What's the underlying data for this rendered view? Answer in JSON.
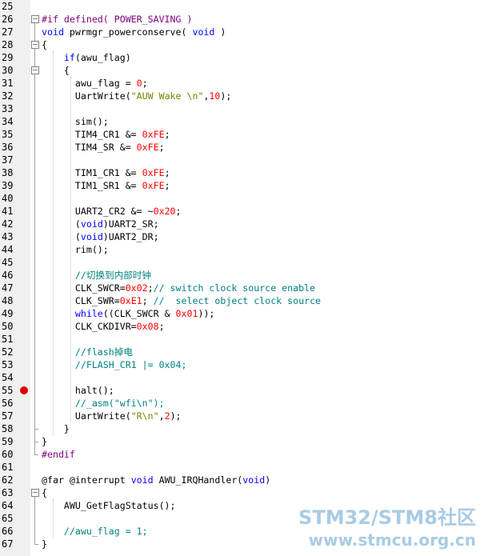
{
  "lines": [
    {
      "n": "25",
      "segs": []
    },
    {
      "n": "26",
      "segs": [
        {
          "t": "#if defined( POWER_SAVING )",
          "c": "pp"
        }
      ]
    },
    {
      "n": "27",
      "segs": [
        {
          "t": "void",
          "c": "kw"
        },
        {
          "t": " pwrmgr_powerconserve( "
        },
        {
          "t": "void",
          "c": "kw"
        },
        {
          "t": " )"
        }
      ]
    },
    {
      "n": "28",
      "segs": [
        {
          "t": "{"
        }
      ]
    },
    {
      "n": "29",
      "segs": [
        {
          "t": "    "
        },
        {
          "t": "if",
          "c": "kw"
        },
        {
          "t": "(awu_flag)"
        }
      ]
    },
    {
      "n": "30",
      "segs": [
        {
          "t": "    {"
        }
      ]
    },
    {
      "n": "31",
      "segs": [
        {
          "t": "      awu_flag = "
        },
        {
          "t": "0",
          "c": "num"
        },
        {
          "t": ";"
        }
      ]
    },
    {
      "n": "32",
      "segs": [
        {
          "t": "      UartWrite("
        },
        {
          "t": "\"AUW Wake \\n\"",
          "c": "str"
        },
        {
          "t": ","
        },
        {
          "t": "10",
          "c": "num"
        },
        {
          "t": ");"
        }
      ]
    },
    {
      "n": "33",
      "segs": []
    },
    {
      "n": "34",
      "segs": [
        {
          "t": "      sim();"
        }
      ]
    },
    {
      "n": "35",
      "segs": [
        {
          "t": "      TIM4_CR1 &= "
        },
        {
          "t": "0xFE",
          "c": "num"
        },
        {
          "t": ";"
        }
      ]
    },
    {
      "n": "36",
      "segs": [
        {
          "t": "      TIM4_SR &= "
        },
        {
          "t": "0xFE",
          "c": "num"
        },
        {
          "t": ";"
        }
      ]
    },
    {
      "n": "37",
      "segs": []
    },
    {
      "n": "38",
      "segs": [
        {
          "t": "      TIM1_CR1 &= "
        },
        {
          "t": "0xFE",
          "c": "num"
        },
        {
          "t": ";"
        }
      ]
    },
    {
      "n": "39",
      "segs": [
        {
          "t": "      TIM1_SR1 &= "
        },
        {
          "t": "0xFE",
          "c": "num"
        },
        {
          "t": ";"
        }
      ]
    },
    {
      "n": "40",
      "segs": []
    },
    {
      "n": "41",
      "segs": [
        {
          "t": "      UART2_CR2 &= ~"
        },
        {
          "t": "0x20",
          "c": "num"
        },
        {
          "t": ";"
        }
      ]
    },
    {
      "n": "42",
      "segs": [
        {
          "t": "      ("
        },
        {
          "t": "void",
          "c": "kw"
        },
        {
          "t": ")UART2_SR;"
        }
      ]
    },
    {
      "n": "43",
      "segs": [
        {
          "t": "      ("
        },
        {
          "t": "void",
          "c": "kw"
        },
        {
          "t": ")UART2_DR;"
        }
      ]
    },
    {
      "n": "44",
      "segs": [
        {
          "t": "      rim();"
        }
      ]
    },
    {
      "n": "45",
      "segs": []
    },
    {
      "n": "46",
      "segs": [
        {
          "t": "      //切换到内部时钟",
          "c": "cmt"
        }
      ]
    },
    {
      "n": "47",
      "segs": [
        {
          "t": "      CLK_SWCR="
        },
        {
          "t": "0x02",
          "c": "num"
        },
        {
          "t": ";"
        },
        {
          "t": "// switch clock source enable",
          "c": "cmt"
        }
      ]
    },
    {
      "n": "48",
      "segs": [
        {
          "t": "      CLK_SWR="
        },
        {
          "t": "0xE1",
          "c": "num"
        },
        {
          "t": "; "
        },
        {
          "t": "//  select object clock source",
          "c": "cmt"
        }
      ]
    },
    {
      "n": "49",
      "segs": [
        {
          "t": "      "
        },
        {
          "t": "while",
          "c": "kw"
        },
        {
          "t": "((CLK_SWCR & "
        },
        {
          "t": "0x01",
          "c": "num"
        },
        {
          "t": "));"
        }
      ]
    },
    {
      "n": "50",
      "segs": [
        {
          "t": "      CLK_CKDIVR="
        },
        {
          "t": "0x08",
          "c": "num"
        },
        {
          "t": ";"
        }
      ]
    },
    {
      "n": "51",
      "segs": []
    },
    {
      "n": "52",
      "segs": [
        {
          "t": "      //flash掉电",
          "c": "cmt"
        }
      ]
    },
    {
      "n": "53",
      "segs": [
        {
          "t": "      //FLASH_CR1 |= 0x04;",
          "c": "cmt"
        }
      ]
    },
    {
      "n": "54",
      "segs": []
    },
    {
      "n": "55",
      "segs": [
        {
          "t": "      halt();"
        }
      ],
      "breakpoint": true
    },
    {
      "n": "56",
      "segs": [
        {
          "t": "      //_asm(\"wfi\\n\");",
          "c": "cmt"
        }
      ]
    },
    {
      "n": "57",
      "segs": [
        {
          "t": "      UartWrite("
        },
        {
          "t": "\"R\\n\"",
          "c": "str"
        },
        {
          "t": ","
        },
        {
          "t": "2",
          "c": "num"
        },
        {
          "t": ");"
        }
      ]
    },
    {
      "n": "58",
      "segs": [
        {
          "t": "    }"
        }
      ]
    },
    {
      "n": "59",
      "segs": [
        {
          "t": "}"
        }
      ]
    },
    {
      "n": "60",
      "segs": [
        {
          "t": "#endif",
          "c": "pp"
        }
      ]
    },
    {
      "n": "61",
      "segs": []
    },
    {
      "n": "62",
      "segs": [
        {
          "t": "@far @interrupt "
        },
        {
          "t": "void",
          "c": "kw"
        },
        {
          "t": " AWU_IRQHandler("
        },
        {
          "t": "void",
          "c": "kw"
        },
        {
          "t": ")"
        }
      ]
    },
    {
      "n": "63",
      "segs": [
        {
          "t": "{"
        }
      ]
    },
    {
      "n": "64",
      "segs": [
        {
          "t": "    AWU_GetFlagStatus();"
        }
      ]
    },
    {
      "n": "65",
      "segs": []
    },
    {
      "n": "66",
      "segs": [
        {
          "t": "    //awu_flag = 1;",
          "c": "cmt"
        }
      ]
    },
    {
      "n": "67",
      "segs": [
        {
          "t": "}"
        }
      ]
    }
  ],
  "watermark": {
    "line1": "STM32/STM8社区",
    "line2": "www.stmcu.org.cn"
  }
}
